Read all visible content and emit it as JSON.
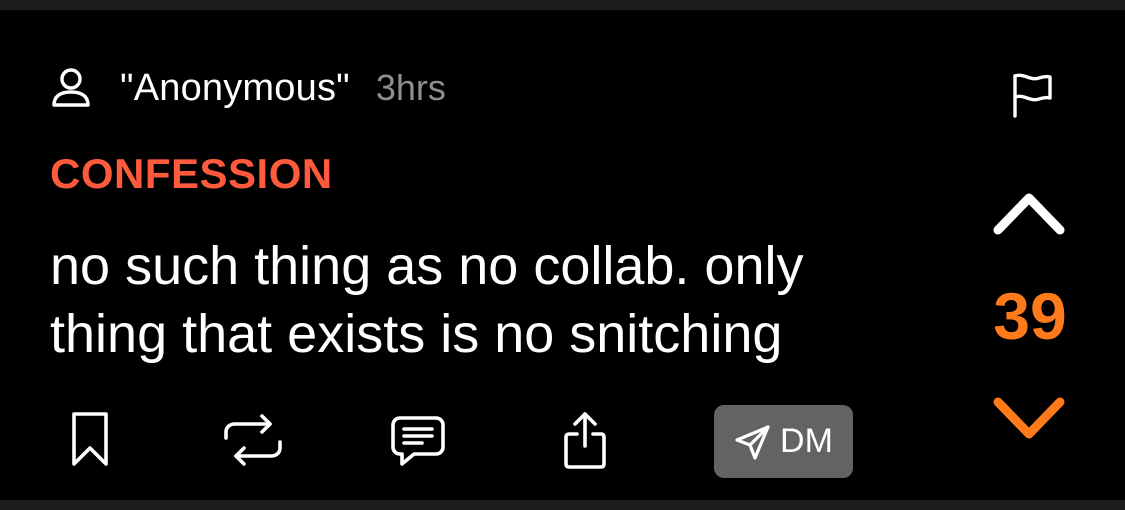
{
  "post": {
    "author": "\"Anonymous\"",
    "time": "3hrs",
    "category": "CONFESSION",
    "text": "no such thing as no collab. only thing that exists is no snitching",
    "vote_count": "39",
    "dm_label": "DM"
  },
  "colors": {
    "background": "#000000",
    "category": "#ff5a3c",
    "vote_accent": "#ff7a1a",
    "muted": "#8e8e93",
    "dm_button": "#636366"
  },
  "icons": {
    "author": "user-icon",
    "report": "flag-icon",
    "upvote": "chevron-up-icon",
    "downvote": "chevron-down-icon",
    "bookmark": "bookmark-icon",
    "repost": "repost-icon",
    "comment": "comment-icon",
    "share": "share-icon",
    "dm": "send-icon"
  }
}
